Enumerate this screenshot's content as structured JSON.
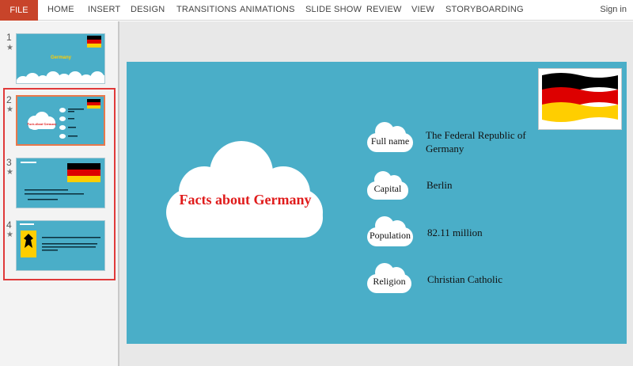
{
  "ribbon": {
    "file": "FILE",
    "tabs": [
      "HOME",
      "INSERT",
      "DESIGN",
      "TRANSITIONS",
      "ANIMATIONS",
      "SLIDE SHOW",
      "REVIEW",
      "VIEW",
      "STORYBOARDING"
    ],
    "signin": "Sign in"
  },
  "thumbnails": [
    {
      "number": "1",
      "star": "★",
      "title": "Germany"
    },
    {
      "number": "2",
      "star": "★",
      "title": "Facts about Germany"
    },
    {
      "number": "3",
      "star": "★"
    },
    {
      "number": "4",
      "star": "★"
    }
  ],
  "slide": {
    "title": "Facts about Germany",
    "items": [
      {
        "label": "Full name",
        "value": "The Federal Republic of Germany"
      },
      {
        "label": "Capital",
        "value": "Berlin"
      },
      {
        "label": "Population",
        "value": "82.11 million"
      },
      {
        "label": "Religion",
        "value": "Christian Catholic"
      }
    ]
  },
  "colors": {
    "file_tab": "#c8442a",
    "slide_bg": "#4aaec8",
    "title_red": "#e01b1b",
    "selection": "#e03a3a",
    "flag_black": "#000000",
    "flag_red": "#dd0000",
    "flag_gold": "#ffce00"
  }
}
